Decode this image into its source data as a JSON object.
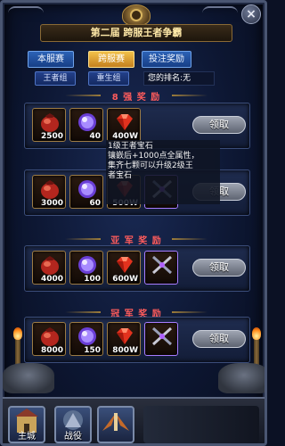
{
  "header": {
    "title": "第二届  跨服王者争霸",
    "close_label": "×"
  },
  "tabs": [
    {
      "label": "本服赛",
      "active": false
    },
    {
      "label": "跨服赛",
      "active": true
    },
    {
      "label": "投注奖励",
      "active": false
    }
  ],
  "subtabs": [
    {
      "label": "王者组"
    },
    {
      "label": "重生组"
    }
  ],
  "rank_text": "您的排名:无",
  "sections": [
    {
      "header": "8 强 奖 励",
      "button": "领取",
      "items": [
        {
          "icon": "red-pouch-icon",
          "qty": "2500"
        },
        {
          "icon": "purple-orb-icon",
          "qty": "40"
        },
        {
          "icon": "ruby-gem-icon",
          "qty": "400W"
        }
      ]
    },
    {
      "header": "",
      "button": "领取",
      "items": [
        {
          "icon": "red-pouch-icon",
          "qty": "3000"
        },
        {
          "icon": "purple-orb-icon",
          "qty": "60"
        },
        {
          "icon": "ruby-gem-icon",
          "qty": "500W"
        },
        {
          "icon": "crossed-swords-icon",
          "qty": ""
        }
      ]
    },
    {
      "header": "亚 军 奖 励",
      "button": "领取",
      "items": [
        {
          "icon": "red-pouch-icon",
          "qty": "4000"
        },
        {
          "icon": "purple-orb-icon",
          "qty": "100"
        },
        {
          "icon": "ruby-gem-icon",
          "qty": "600W"
        },
        {
          "icon": "crossed-swords-icon",
          "qty": ""
        }
      ]
    },
    {
      "header": "冠 军 奖 励",
      "button": "领取",
      "items": [
        {
          "icon": "red-pouch-icon",
          "qty": "8000"
        },
        {
          "icon": "purple-orb-icon",
          "qty": "150"
        },
        {
          "icon": "ruby-gem-icon",
          "qty": "800W"
        },
        {
          "icon": "crossed-swords-icon",
          "qty": ""
        }
      ]
    }
  ],
  "tooltip": {
    "line1": "1级王者宝石",
    "line2": "镶嵌后+1000点全属性，",
    "line3": "集齐七颗可以升级2级王",
    "line4": "者宝石"
  },
  "bottom_nav": [
    {
      "label": "主城",
      "icon": "castle-icon"
    },
    {
      "label": "战役",
      "icon": "battle-icon"
    },
    {
      "label": "",
      "icon": "wings-icon"
    }
  ]
}
